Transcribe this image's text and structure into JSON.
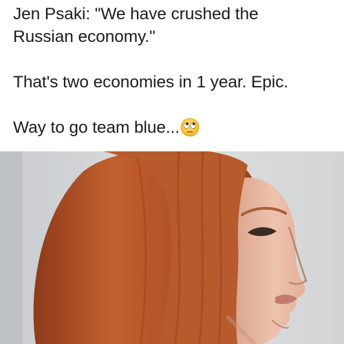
{
  "post": {
    "lines": [
      "Jen Psaki: \"We have crushed the",
      "Russian economy.\"",
      "That's two economies in 1 year. Epic.",
      "Way to go team blue..."
    ],
    "emoji_icon": "face-with-rolling-eyes-icon"
  },
  "photo": {
    "subject": "woman-with-red-hair-profile-photo",
    "colors": {
      "background": "#d9dbdd",
      "hair": "#b7532a",
      "skin": "#e9b9a2"
    }
  }
}
